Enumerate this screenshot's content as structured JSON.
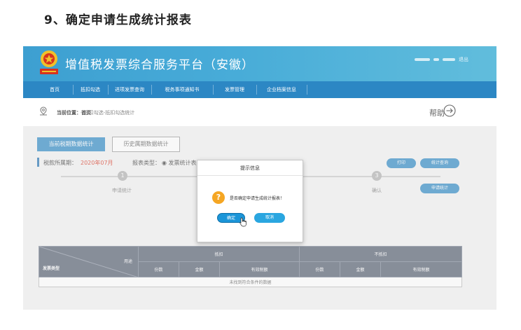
{
  "doc_heading": "9、确定申请生成统计报表",
  "header": {
    "platform_title": "增值税发票综合服务平台（安徽）",
    "logout_label": "退出"
  },
  "nav": {
    "items": [
      "首页",
      "抵扣勾选",
      "进项发票查询",
      "税务事项通知书",
      "发票管理",
      "企业档案信息"
    ]
  },
  "breadcrumb": {
    "label": "当前位置：首页",
    "path": " - 抵扣勾选-抵扣勾选统计",
    "help_label": "帮助"
  },
  "tabs": {
    "current": "当前税期数据统计",
    "history": "历史属期数据统计"
  },
  "filters": {
    "period_label": "税款所属期：",
    "period_value": "2020年07月",
    "type_label": "报表类型：",
    "type_option": "◉ 发票统计表"
  },
  "actions": {
    "print": "打印",
    "stats_query": "统计查询",
    "apply_stats": "申请统计"
  },
  "steps": [
    {
      "number": "1",
      "label": "申请统计"
    },
    {
      "number": "3",
      "label": "确认"
    }
  ],
  "table": {
    "corner_type": "发票类型",
    "corner_purpose": "用途",
    "group_deduct": "抵扣",
    "group_nondeduct": "不抵扣",
    "cols": [
      "份数",
      "金额",
      "有效税额",
      "份数",
      "金额",
      "有效税额"
    ],
    "empty_text": "未找到符合条件的数据"
  },
  "dialog": {
    "title": "提示信息",
    "message": "是否确定申请生成统计报表！",
    "ok": "确定",
    "cancel": "取消"
  },
  "colors": {
    "nav_bg": "#2c87c4",
    "accent": "#1b95d8",
    "warning": "#f5a623",
    "period_red": "#d8321e",
    "table_header": "#525c6e"
  }
}
